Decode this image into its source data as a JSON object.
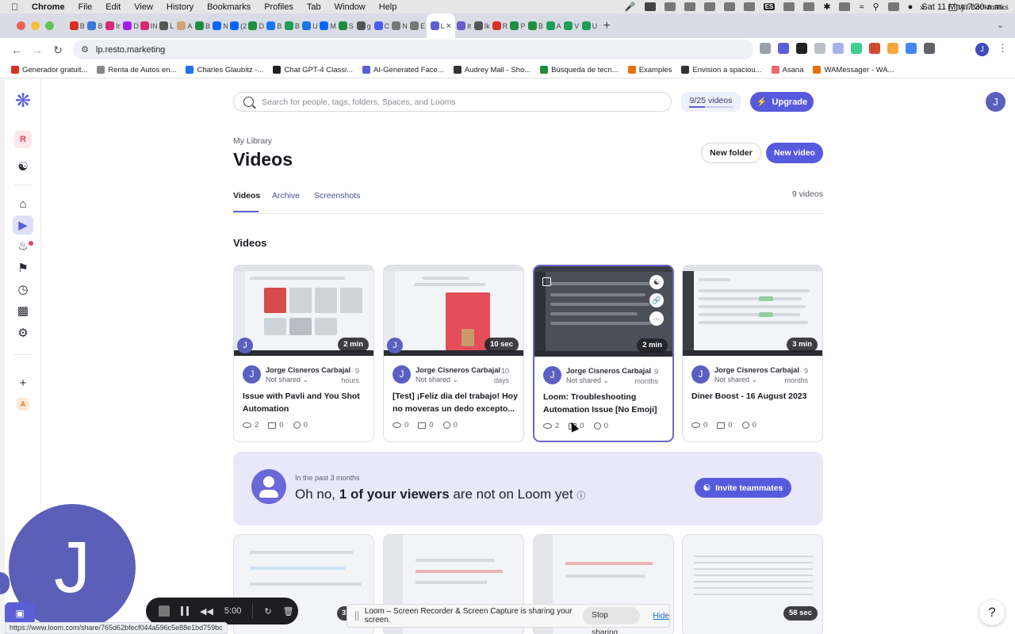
{
  "menubar": {
    "items": [
      "Chrome",
      "File",
      "Edit",
      "View",
      "History",
      "Bookmarks",
      "Profiles",
      "Tab",
      "Window",
      "Help"
    ],
    "input_source": "ES",
    "datetime": "Sat 11 May  7:30 a.m."
  },
  "tabs": [
    {
      "short": "B",
      "color": "#d93025"
    },
    {
      "short": "B",
      "color": "#3a7bd5"
    },
    {
      "short": "Ir",
      "color": "#d62976"
    },
    {
      "short": "D",
      "color": "#a020f0"
    },
    {
      "short": "IN",
      "color": "#d62976"
    },
    {
      "short": "L",
      "color": "#555555"
    },
    {
      "short": "A",
      "color": "#d4a373"
    },
    {
      "short": "B",
      "color": "#1e8e3e"
    },
    {
      "short": "N",
      "color": "#0866ff"
    },
    {
      "short": "(2",
      "color": "#0866ff"
    },
    {
      "short": "D",
      "color": "#1e8e3e"
    },
    {
      "short": "B",
      "color": "#1877f2"
    },
    {
      "short": "B",
      "color": "#1e9e57"
    },
    {
      "short": "U",
      "color": "#1a73e8"
    },
    {
      "short": "M",
      "color": "#0866ff"
    },
    {
      "short": "S",
      "color": "#1e8e3e"
    },
    {
      "short": "g",
      "color": "#555555"
    },
    {
      "short": "C",
      "color": "#4a5af0"
    },
    {
      "short": "N",
      "color": "#777777"
    },
    {
      "short": "E",
      "color": "#777777"
    },
    {
      "short": "L",
      "color": "#5b5fd6",
      "active": true
    },
    {
      "short": "It",
      "color": "#6a5acd"
    },
    {
      "short": "Ik",
      "color": "#555555"
    },
    {
      "short": "R",
      "color": "#d93025"
    },
    {
      "short": "P",
      "color": "#1e8e3e"
    },
    {
      "short": "B",
      "color": "#1e8e3e"
    },
    {
      "short": "A",
      "color": "#1e9e57"
    },
    {
      "short": "V",
      "color": "#1e9e57"
    },
    {
      "short": "U",
      "color": "#1e9e57"
    }
  ],
  "toolbar": {
    "url": "lp.resto.marketing",
    "profile_initial": "J"
  },
  "bookmarks": [
    {
      "label": "Generador gratuit...",
      "color": "#d93025"
    },
    {
      "label": "Renta de Autos en...",
      "color": "#888888"
    },
    {
      "label": "Charles Glaubitz -...",
      "color": "#1a73e8"
    },
    {
      "label": "Chat GPT-4 Classi...",
      "color": "#222222"
    },
    {
      "label": "AI-Generated Face...",
      "color": "#5b5fd6"
    },
    {
      "label": "Audrey Mall - Sho...",
      "color": "#333333"
    },
    {
      "label": "Búsqueda de tecn...",
      "color": "#1e8e3e"
    },
    {
      "label": "Examples",
      "color": "#e8710a"
    },
    {
      "label": "Envision a spaciou...",
      "color": "#333333"
    },
    {
      "label": "Asana",
      "color": "#f06a6a"
    },
    {
      "label": "WAMessager - WA...",
      "color": "#e8710a"
    }
  ],
  "bookmarks_all": "All Bookmarks",
  "sidebar": {
    "workspace_initial": "R",
    "workspace2_initial": "A"
  },
  "search": {
    "placeholder": "Search for people, tags, folders, Spaces, and Looms"
  },
  "quota": {
    "label": "9/25 videos",
    "fraction": 0.36
  },
  "upgrade_label": "Upgrade",
  "user_initial": "J",
  "header": {
    "breadcrumb": "My Library",
    "title": "Videos",
    "new_folder": "New folder",
    "new_video": "New video"
  },
  "library_tabs": [
    {
      "label": "Videos",
      "active": true
    },
    {
      "label": "Archive",
      "active": false
    },
    {
      "label": "Screenshots",
      "active": false
    }
  ],
  "video_count": "9 videos",
  "section_title": "Videos",
  "videos": [
    {
      "duration": "2 min",
      "owner": "Jorge Cisneros Carbajal",
      "ago1": "· 9",
      "ago2": "hours",
      "shared": "Not shared",
      "title": "Issue with Pavli and You Shot Automation",
      "views": "2",
      "comments": "0",
      "reactions": "0"
    },
    {
      "duration": "10 sec",
      "owner": "Jorge Cisneros Carbajal",
      "ago1": "· 10",
      "ago2": "days",
      "shared": "Not shared",
      "title": "[Test] ¡Feliz dia del trabajo! Hoy no moveras un dedo excepto...",
      "views": "0",
      "comments": "0",
      "reactions": "0"
    },
    {
      "duration": "2 min",
      "owner": "Jorge Cisneros Carbajal",
      "ago1": "· 9",
      "ago2": "months",
      "shared": "Not shared",
      "title": "Loom: Troubleshooting Automation Issue [No Emoji]",
      "views": "2",
      "comments": "0",
      "reactions": "0"
    },
    {
      "duration": "3 min",
      "owner": "Jorge Cisneros Carbajal",
      "ago1": "· 9",
      "ago2": "months",
      "shared": "Not shared",
      "title": "Diner Boost - 16 August 2023",
      "views": "0",
      "comments": "0",
      "reactions": "0"
    }
  ],
  "owner_initial": "J",
  "banner": {
    "subtitle": "In the past 3 months",
    "pre": "Oh no, ",
    "bold": "1 of your viewers",
    "post": " are not on Loom yet",
    "invite": "Invite teammates"
  },
  "row2_durations": {
    "first_partial": "3",
    "last": "58 sec"
  },
  "camera_initial": "J",
  "recorder": {
    "time": "5:00"
  },
  "share_notice": {
    "message": "Loom – Screen Recorder & Screen Capture is sharing your screen.",
    "stop": "Stop sharing",
    "hide": "Hide"
  },
  "help_label": "?",
  "status_url": "https://www.loom.com/share/765d62bfecf044a596c5e88e1bd759bc"
}
